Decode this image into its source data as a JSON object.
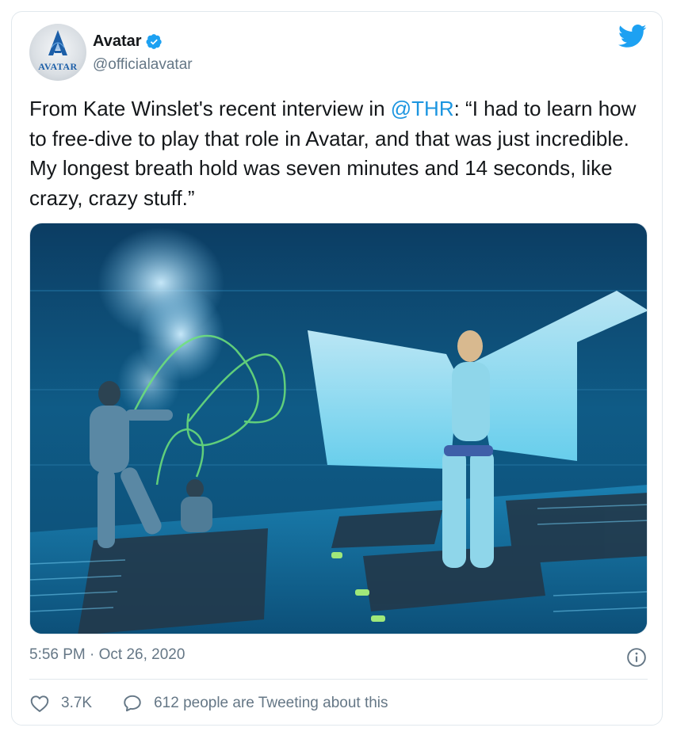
{
  "author": {
    "display_name": "Avatar",
    "handle": "@officialavatar",
    "avatar_text": "AVATAR",
    "verified": true
  },
  "tweet": {
    "text_before": "From Kate Winslet's recent interview in ",
    "mention": "@THR",
    "text_after": ": “I had to learn how to free-dive to play that role in Avatar, and that was just incredible. My longest breath hold was seven minutes and 14 seconds, like crazy, crazy stuff.”"
  },
  "media": {
    "alt": "Underwater film set photo"
  },
  "meta": {
    "timestamp": "5:56 PM · Oct 26, 2020"
  },
  "actions": {
    "like_count": "3.7K",
    "reply_text": "612 people are Tweeting about this"
  },
  "icons": {
    "twitter_logo": "twitter-bird-icon",
    "verified": "verified-badge-icon",
    "info": "info-icon",
    "like": "heart-icon",
    "reply": "speech-bubble-icon"
  },
  "colors": {
    "link": "#1b95e0",
    "text": "#14171a",
    "secondary": "#657786",
    "twitter_blue": "#1da1f2"
  }
}
